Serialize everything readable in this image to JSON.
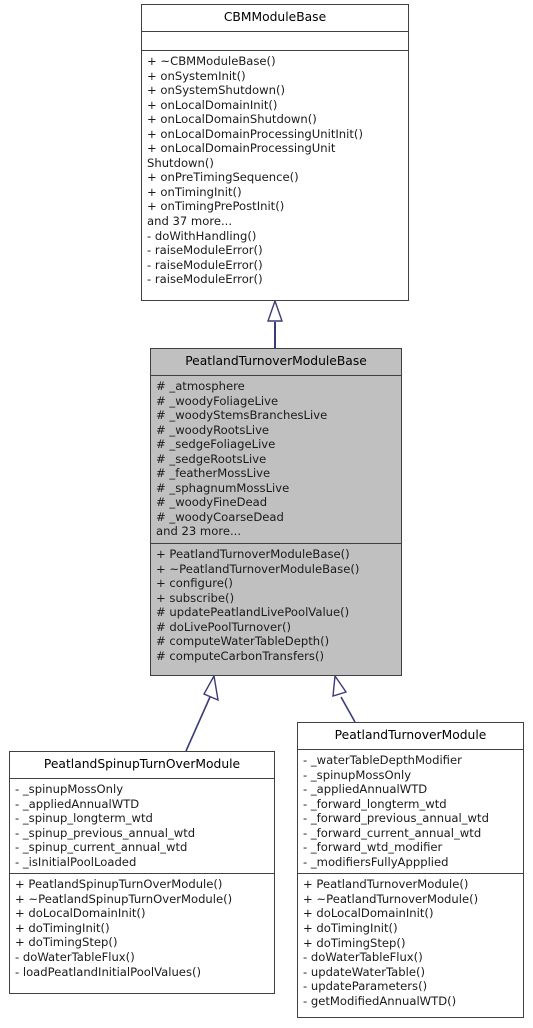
{
  "diagram": {
    "kind": "uml-class-inheritance-diagram",
    "background": "#ffffff",
    "edge_color": "#3b3b7a",
    "node_border_color": "#404040",
    "node_fill_highlight": "#c0c0c0",
    "node_fill_default": "#ffffff"
  },
  "nodes": {
    "cbm_module_base": {
      "title": "CBMModuleBase",
      "attributes": [],
      "methods": [
        "+ ~CBMModuleBase()",
        "+ onSystemInit()",
        "+ onSystemShutdown()",
        "+ onLocalDomainInit()",
        "+ onLocalDomainShutdown()",
        "+ onLocalDomainProcessingUnitInit()",
        "+ onLocalDomainProcessingUnit Shutdown()",
        "+ onPreTimingSequence()",
        "+ onTimingInit()",
        "+ onTimingPrePostInit()",
        "and 37 more...",
        "- doWithHandling()",
        "- raiseModuleError()",
        "- raiseModuleError()",
        "- raiseModuleError()"
      ]
    },
    "peatland_turnover_module_base": {
      "title": "PeatlandTurnoverModuleBase",
      "attributes": [
        "#  _atmosphere",
        "#  _woodyFoliageLive",
        "#  _woodyStemsBranchesLive",
        "#  _woodyRootsLive",
        "#  _sedgeFoliageLive",
        "#  _sedgeRootsLive",
        "#  _featherMossLive",
        "#  _sphagnumMossLive",
        "#  _woodyFineDead",
        "#  _woodyCoarseDead",
        "and 23 more..."
      ],
      "methods": [
        "+ PeatlandTurnoverModuleBase()",
        "+ ~PeatlandTurnoverModuleBase()",
        "+ configure()",
        "+ subscribe()",
        "# updatePeatlandLivePoolValue()",
        "# doLivePoolTurnover()",
        "# computeWaterTableDepth()",
        "# computeCarbonTransfers()"
      ]
    },
    "peatland_spinup_turnover_module": {
      "title": "PeatlandSpinupTurnOverModule",
      "attributes": [
        "-  _spinupMossOnly",
        "-  _appliedAnnualWTD",
        "-  _spinup_longterm_wtd",
        "-  _spinup_previous_annual_wtd",
        "-  _spinup_current_annual_wtd",
        "-  _isInitialPoolLoaded"
      ],
      "methods": [
        "+ PeatlandSpinupTurnOverModule()",
        "+ ~PeatlandSpinupTurnOverModule()",
        "+ doLocalDomainInit()",
        "+ doTimingInit()",
        "+ doTimingStep()",
        "- doWaterTableFlux()",
        "- loadPeatlandInitialPoolValues()"
      ]
    },
    "peatland_turnover_module": {
      "title": "PeatlandTurnoverModule",
      "attributes": [
        "-  _waterTableDepthModifier",
        "-  _spinupMossOnly",
        "-  _appliedAnnualWTD",
        "-  _forward_longterm_wtd",
        "-  _forward_previous_annual_wtd",
        "-  _forward_current_annual_wtd",
        "-  _forward_wtd_modifier",
        "-  _modifiersFullyAppplied"
      ],
      "methods": [
        "+ PeatlandTurnoverModule()",
        "+ ~PeatlandTurnoverModule()",
        "+ doLocalDomainInit()",
        "+ doTimingInit()",
        "+ doTimingStep()",
        "- doWaterTableFlux()",
        "- updateWaterTable()",
        "- updateParameters()",
        "- getModifiedAnnualWTD()"
      ]
    }
  },
  "edges": [
    {
      "name": "inheritance-base-to-turnover-base",
      "from": "peatland_turnover_module_base",
      "to": "cbm_module_base",
      "style": "generalization"
    },
    {
      "name": "inheritance-turnoverbase-to-spinup",
      "from": "peatland_spinup_turnover_module",
      "to": "peatland_turnover_module_base",
      "style": "generalization"
    },
    {
      "name": "inheritance-turnoverbase-to-turnover",
      "from": "peatland_turnover_module",
      "to": "peatland_turnover_module_base",
      "style": "generalization"
    }
  ]
}
